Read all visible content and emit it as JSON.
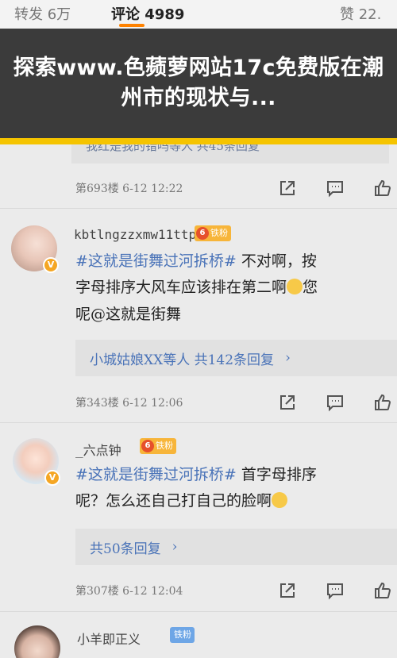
{
  "tabs": {
    "repost": "转发 6万",
    "comment": "评论 4989",
    "like": "赞 22."
  },
  "overlay": {
    "title": "探索www.色𬞟萝网站17c免费版在潮州市的现状与..."
  },
  "colors": {
    "accent": "#ff8200",
    "overlay_bar": "#f5c400",
    "link": "#4a73b8",
    "fan_badge": "#f7b53a"
  },
  "comment0": {
    "reply_text": "我红是我的错吗等人 共45条回复",
    "meta": "第693楼 6-12 12:22"
  },
  "comment1": {
    "username": "kbtlngzzxmw11ttp",
    "badge": "铁粉",
    "badge_level": "6",
    "hashtag": "#这就是街舞过河拆桥#",
    "line1_rest": " 不对啊，按",
    "line2": "字母排序大风车应该排在第二啊",
    "line2_rest": "您",
    "line3": "呢@这就是街舞",
    "reply_text": "小城姑娘XX等人 共142条回复",
    "meta": "第343楼 6-12 12:06"
  },
  "comment2": {
    "username": "_六点钟",
    "badge": "铁粉",
    "badge_level": "6",
    "hashtag": "#这就是街舞过河拆桥#",
    "line1_rest": " 首字母排序",
    "line2": "呢？怎么还自己打自己的脸啊",
    "reply_text": "共50条回复",
    "meta": "第307楼 6-12 12:04"
  },
  "comment3": {
    "username": "小羊即正义",
    "badge": "铁粉"
  },
  "icons": [
    "share-icon",
    "comment-icon",
    "like-icon",
    "chevron-right-icon",
    "verified-badge-icon"
  ]
}
